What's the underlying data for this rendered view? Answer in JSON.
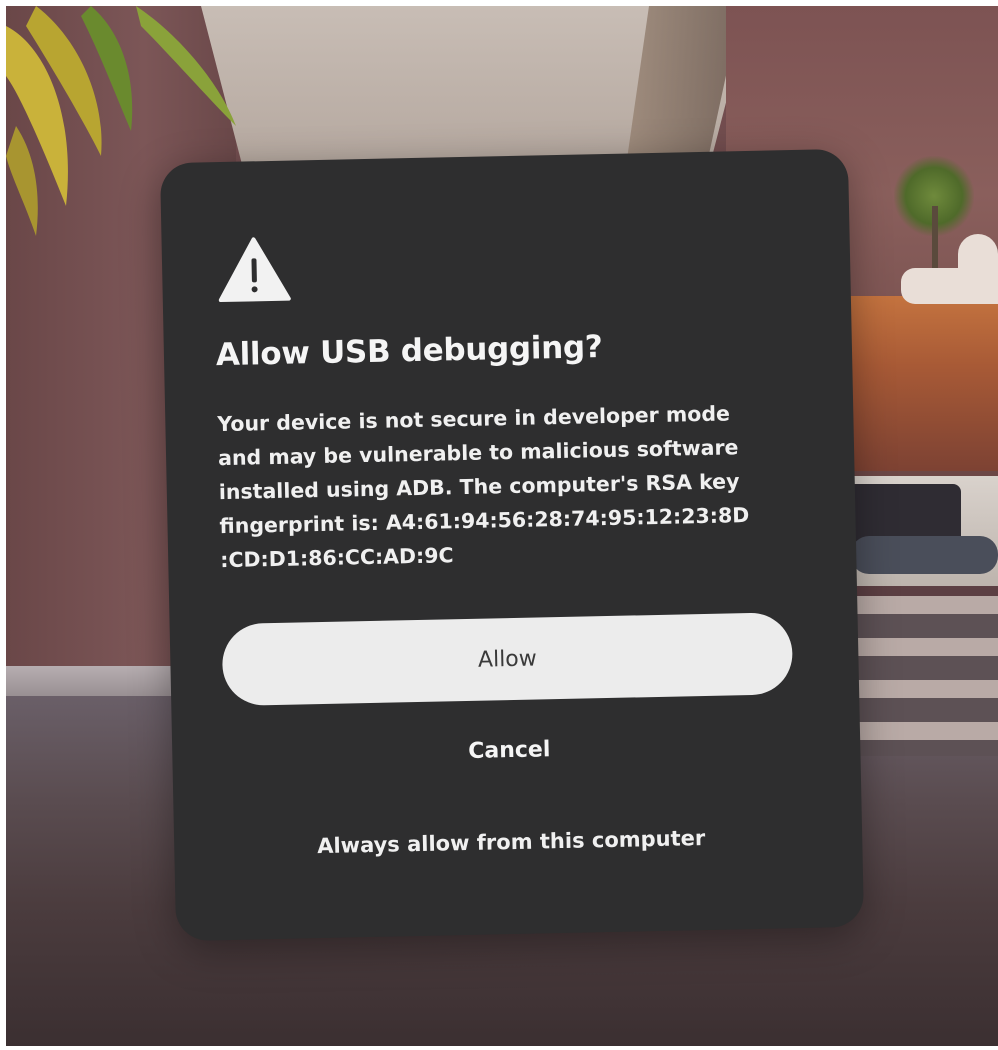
{
  "dialog": {
    "icon": "warning-triangle-icon",
    "title": "Allow USB debugging?",
    "message_lines": [
      "Your device is not secure in developer mode",
      "and may be vulnerable to malicious software",
      "installed using ADB. The computer's RSA key",
      "fingerprint is: A4:61:94:56:28:74:95:12:23:8D",
      ":CD:D1:86:CC:AD:9C"
    ],
    "allow_label": "Allow",
    "cancel_label": "Cancel",
    "always_allow_label": "Always allow from this computer"
  },
  "colors": {
    "dialog_background": "#2e2e2f",
    "primary_button": "#ececec",
    "text": "#f2f2f2"
  }
}
